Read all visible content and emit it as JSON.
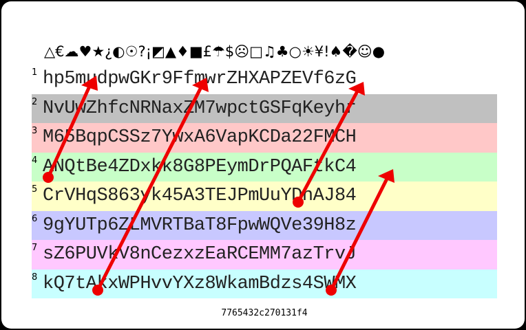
{
  "symbol_string": "△€☁♥★¿◐☉?¡◩▲♦■£☂$☹□♫♣○☀¥!♠�☺●",
  "rows": [
    {
      "num": "1",
      "text": "hp5mudpwGKr9FfmwrZHXAPZEVf6zG",
      "bg": "#ffffff"
    },
    {
      "num": "2",
      "text": "NvUwZhfcNRNaxZM7wpctGSFqKeyhr",
      "bg": "#c0c0c0"
    },
    {
      "num": "3",
      "text": "M65BqpCSSz7YwxA6VapKCDa22FMCH",
      "bg": "#ffc8c8"
    },
    {
      "num": "4",
      "text": "ANQtBe4ZDxkk8G8PEymDrPQAFtkC4",
      "bg": "#c8ffc8"
    },
    {
      "num": "5",
      "text": "CrVHqS863yk45A3TEJPmUuYDnAJ84",
      "bg": "#ffffc8"
    },
    {
      "num": "6",
      "text": "9gYUTp6ZLMVRTBaT8FpwWQVe39H8z",
      "bg": "#c8c8ff"
    },
    {
      "num": "7",
      "text": "sZ6PUVkV8nCezxzEaRCEMM7azTrvJ",
      "bg": "#ffc8ff"
    },
    {
      "num": "8",
      "text": "kQ7tAkxWPHvvYXz8WkamBdzs4SWMX",
      "bg": "#c8ffff"
    }
  ],
  "footer_code": "7765432c270131f4",
  "arrow_color": "#ee0000"
}
